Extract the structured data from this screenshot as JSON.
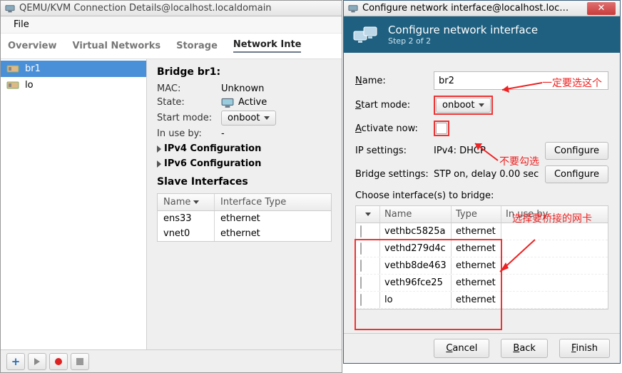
{
  "main": {
    "title": "QEMU/KVM Connection Details@localhost.localdomain",
    "menu": {
      "file": "File"
    },
    "tabs": [
      "Overview",
      "Virtual Networks",
      "Storage",
      "Network Inte"
    ],
    "active_tab": 3,
    "sidebar": [
      {
        "name": "br1",
        "selected": true
      },
      {
        "name": "lo",
        "selected": false
      }
    ],
    "detail": {
      "heading": "Bridge br1:",
      "mac_label": "MAC:",
      "mac_value": "Unknown",
      "state_label": "State:",
      "state_value": "Active",
      "startmode_label": "Start mode:",
      "startmode_value": "onboot",
      "inuse_label": "In use by:",
      "inuse_value": "-",
      "ipv4": "IPv4 Configuration",
      "ipv6": "IPv6 Configuration",
      "slaves_heading": "Slave Interfaces",
      "table": {
        "col_name": "Name",
        "col_type": "Interface Type",
        "rows": [
          {
            "name": "ens33",
            "type": "ethernet"
          },
          {
            "name": "vnet0",
            "type": "ethernet"
          }
        ]
      }
    }
  },
  "dialog": {
    "title": "Configure network interface@localhost.localdomain",
    "header_title": "Configure network interface",
    "header_sub": "Step 2 of 2",
    "name_label": "Name:",
    "name_value": "br2",
    "startmode_label": "Start mode:",
    "startmode_value": "onboot",
    "activate_label": "Activate now:",
    "ip_label": "IP settings:",
    "ip_value": "IPv4: DHCP",
    "bridge_label": "Bridge settings:",
    "bridge_value": "STP on, delay 0.00 sec",
    "configure_btn": "Configure",
    "choose_label": "Choose interface(s) to bridge:",
    "table": {
      "col_name": "Name",
      "col_type": "Type",
      "col_inuse": "In use by",
      "rows": [
        {
          "name": "vethbc5825a",
          "type": "ethernet"
        },
        {
          "name": "vethd279d4c",
          "type": "ethernet"
        },
        {
          "name": "vethb8de463",
          "type": "ethernet"
        },
        {
          "name": "veth96fce25",
          "type": "ethernet"
        },
        {
          "name": "lo",
          "type": "ethernet"
        }
      ]
    },
    "buttons": {
      "cancel": "Cancel",
      "back": "Back",
      "finish": "Finish"
    }
  },
  "annotations": {
    "a1": "一定要选这个",
    "a2": "不要勾选",
    "a3": "选择要桥接的网卡"
  }
}
